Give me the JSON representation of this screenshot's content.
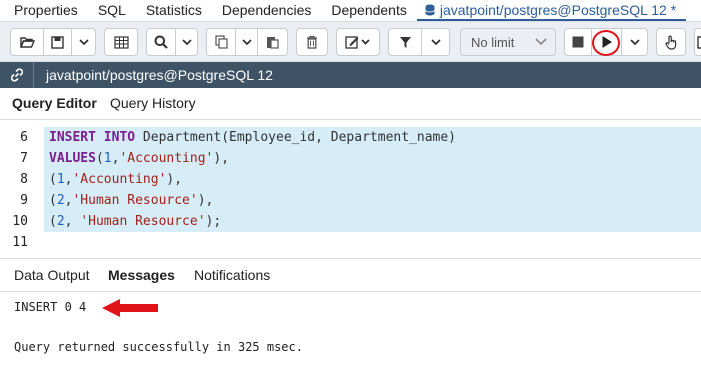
{
  "tabs": {
    "properties": "Properties",
    "sql": "SQL",
    "statistics": "Statistics",
    "dependencies": "Dependencies",
    "dependents": "Dependents",
    "query_tab": "javatpoint/postgres@PostgreSQL 12 *"
  },
  "toolbar": {
    "limit_value": "No limit"
  },
  "connection": {
    "label": "javatpoint/postgres@PostgreSQL 12"
  },
  "editor_tabs": {
    "query_editor": "Query Editor",
    "query_history": "Query History"
  },
  "editor": {
    "lines": [
      {
        "number": "6",
        "tokens": [
          [
            "kw",
            "INSERT"
          ],
          [
            "pl",
            " "
          ],
          [
            "kw",
            "INTO"
          ],
          [
            "pl",
            " Department(Employee_id, Department_name)"
          ]
        ]
      },
      {
        "number": "7",
        "tokens": [
          [
            "kw",
            "VALUES"
          ],
          [
            "pl",
            "("
          ],
          [
            "num",
            "1"
          ],
          [
            "pl",
            ","
          ],
          [
            "str",
            "'Accounting'"
          ],
          [
            "pl",
            "),"
          ]
        ]
      },
      {
        "number": "8",
        "tokens": [
          [
            "pl",
            "("
          ],
          [
            "num",
            "1"
          ],
          [
            "pl",
            ","
          ],
          [
            "str",
            "'Accounting'"
          ],
          [
            "pl",
            "),"
          ]
        ]
      },
      {
        "number": "9",
        "tokens": [
          [
            "pl",
            "("
          ],
          [
            "num",
            "2"
          ],
          [
            "pl",
            ","
          ],
          [
            "str",
            "'Human Resource'"
          ],
          [
            "pl",
            "),"
          ]
        ]
      },
      {
        "number": "10",
        "tokens": [
          [
            "pl",
            "("
          ],
          [
            "num",
            "2"
          ],
          [
            "pl",
            ", "
          ],
          [
            "str",
            "'Human Resource'"
          ],
          [
            "pl",
            ");"
          ]
        ]
      },
      {
        "number": "11",
        "tokens": []
      }
    ]
  },
  "result_tabs": {
    "data_output": "Data Output",
    "messages": "Messages",
    "notifications": "Notifications"
  },
  "messages": {
    "insert_result": "INSERT 0 4",
    "summary": "Query returned successfully in 325 msec."
  },
  "colors": {
    "accent": "#2e5d9a",
    "connection_bar": "#3f5366",
    "selection": "#d6ecf7",
    "annotation_red": "#e0131b"
  }
}
